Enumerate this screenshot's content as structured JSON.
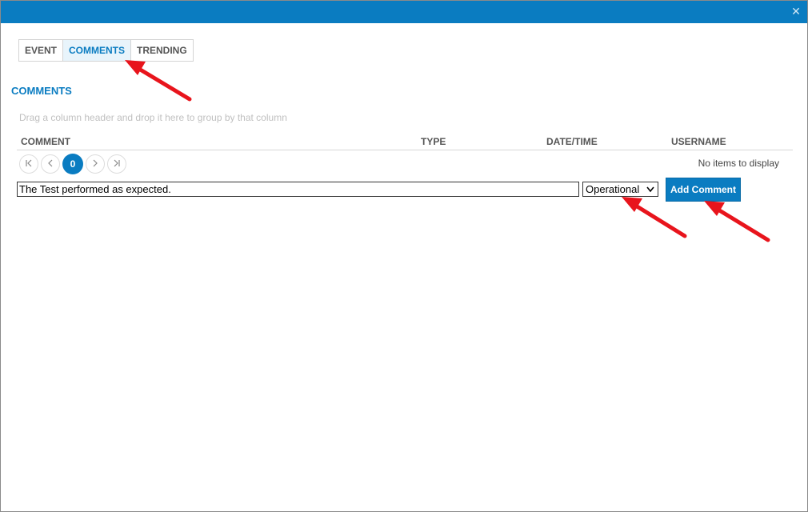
{
  "window": {
    "close_glyph": "✕"
  },
  "tabs": [
    {
      "label": "EVENT",
      "active": false
    },
    {
      "label": "COMMENTS",
      "active": true
    },
    {
      "label": "TRENDING",
      "active": false
    }
  ],
  "section": {
    "title": "COMMENTS"
  },
  "grid": {
    "group_hint": "Drag a column header and drop it here to group by that column",
    "columns": [
      "COMMENT",
      "TYPE",
      "DATE/TIME",
      "USERNAME"
    ],
    "pager": {
      "current_page": "0"
    },
    "empty_message": "No items to display"
  },
  "new_comment": {
    "text": "The Test performed as expected.",
    "type_selected": "Operational",
    "add_label": "Add Comment"
  },
  "colors": {
    "accent": "#0a7cc1",
    "annotation_arrow": "#e8141c"
  }
}
